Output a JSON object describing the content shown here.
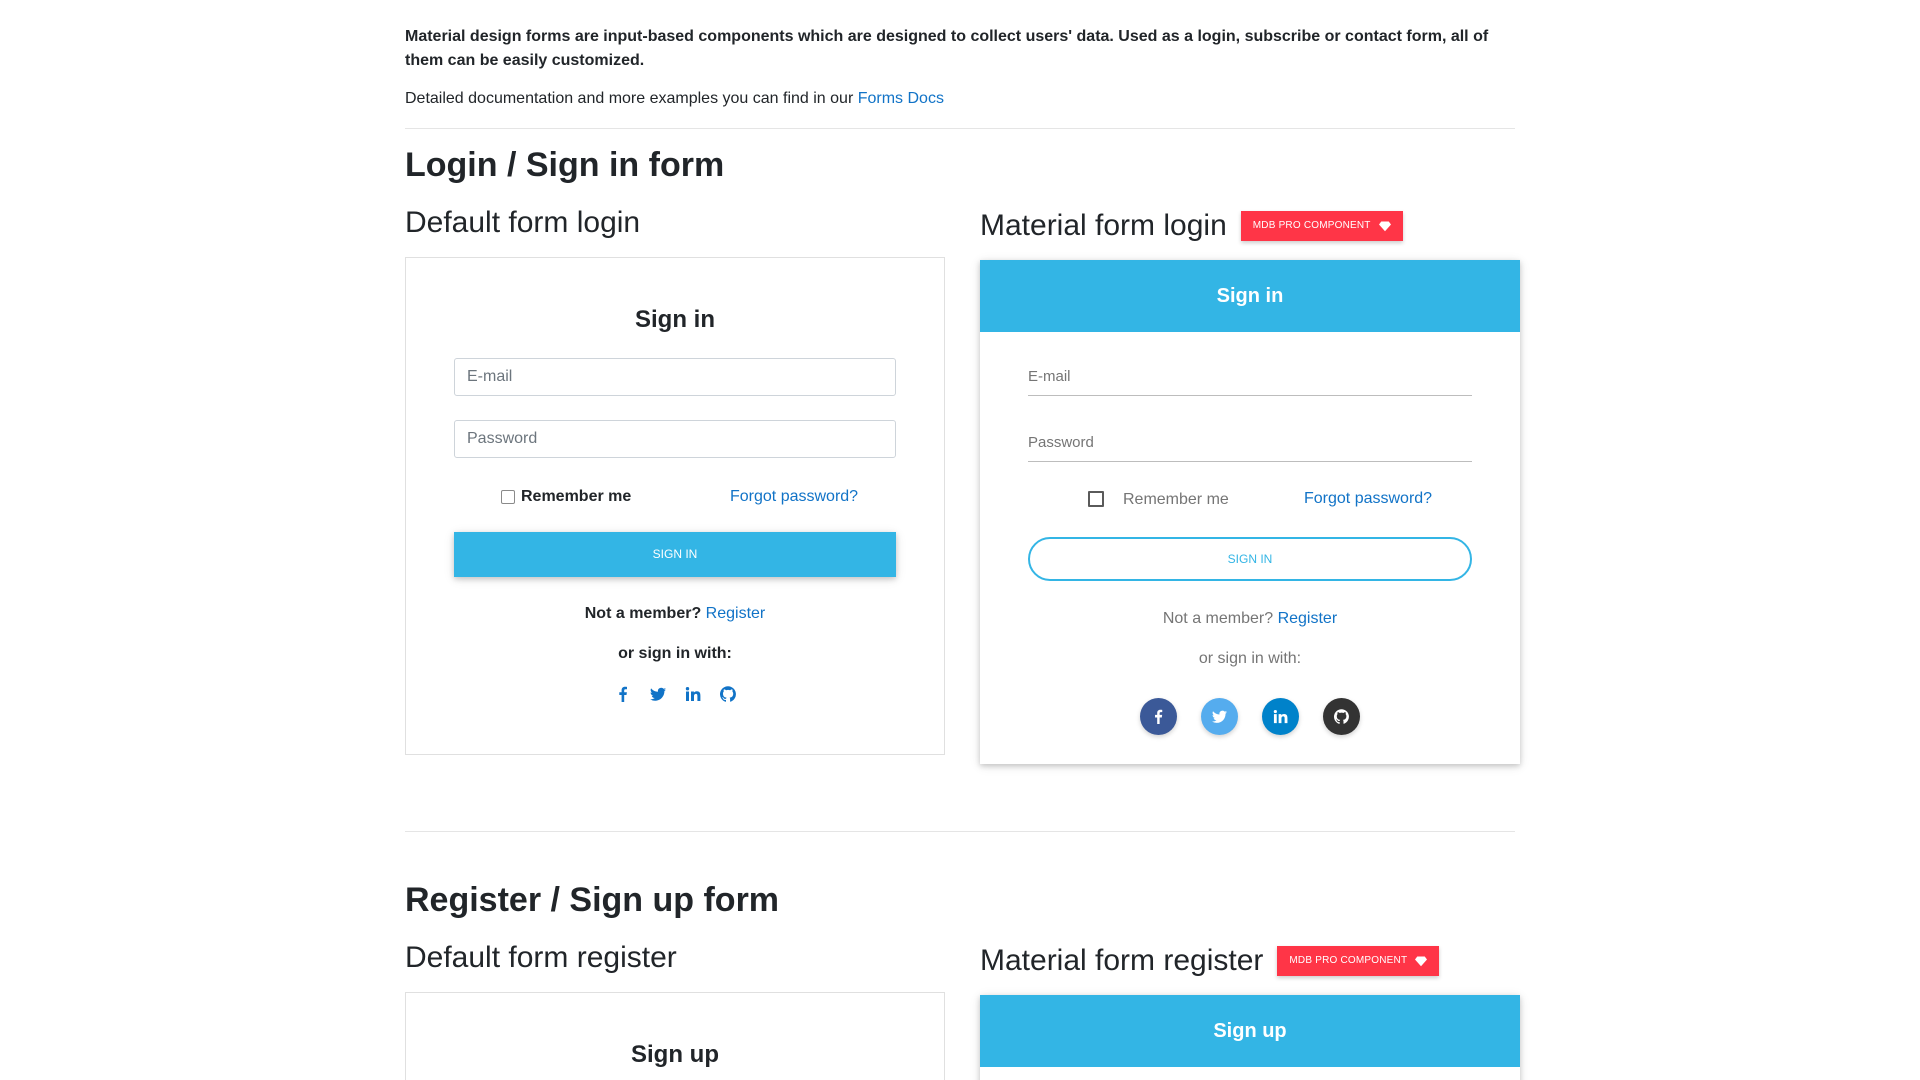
{
  "intro": {
    "paragraph": "Material design forms are input-based components which are designed to collect users' data. Used as a login, subscribe or contact form, all of them can be easily customized.",
    "docs_prefix": "Detailed documentation and more examples you can find in our ",
    "docs_link": "Forms Docs"
  },
  "login_section": {
    "title": "Login / Sign in form",
    "default": {
      "heading": "Default form login",
      "card_title": "Sign in",
      "email_placeholder": "E-mail",
      "password_placeholder": "Password",
      "remember_label": "Remember me",
      "forgot_link": "Forgot password?",
      "submit_label": "Sign in",
      "not_member": "Not a member?",
      "register_link": "Register",
      "or_sign_in": "or sign in with:"
    },
    "material": {
      "heading": "Material form login",
      "badge": "MDB Pro component",
      "card_title": "Sign in",
      "email_placeholder": "E-mail",
      "password_placeholder": "Password",
      "remember_label": "Remember me",
      "forgot_link": "Forgot password?",
      "submit_label": "Sign in",
      "not_member": "Not a member?",
      "register_link": "Register",
      "or_sign_in": "or sign in with:"
    }
  },
  "register_section": {
    "title": "Register / Sign up form",
    "default": {
      "heading": "Default form register",
      "card_title": "Sign up"
    },
    "material": {
      "heading": "Material form register",
      "badge": "MDB Pro component",
      "card_title": "Sign up"
    }
  },
  "social": [
    "facebook-icon",
    "twitter-icon",
    "linkedin-icon",
    "github-icon"
  ],
  "colors": {
    "primary": "#33b5e5",
    "link": "#1173c7",
    "badge": "#ff3547",
    "facebook": "#3b5998",
    "twitter": "#55acee",
    "linkedin": "#0082ca",
    "github": "#333333"
  }
}
